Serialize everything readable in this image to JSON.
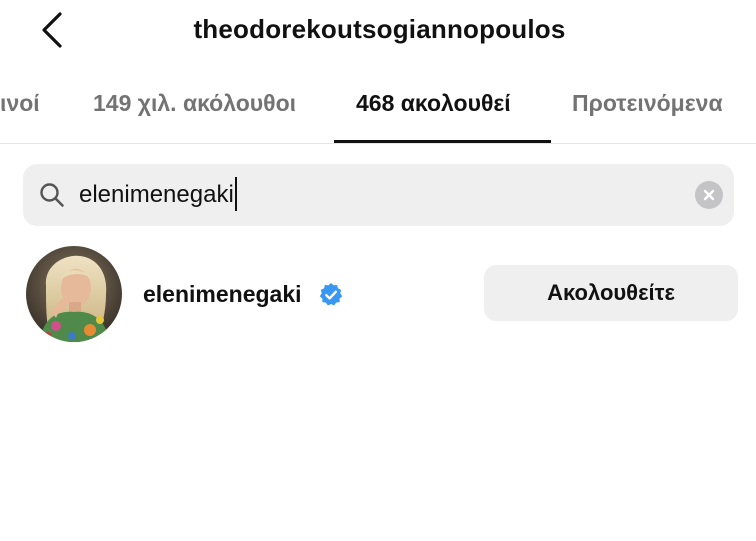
{
  "header": {
    "title": "theodorekoutsogiannopoulos",
    "back_icon": "chevron-left-icon"
  },
  "tabs": [
    {
      "label": "οινοί",
      "active": false
    },
    {
      "label": "149 χιλ. ακόλουθοι",
      "active": false
    },
    {
      "label": "468 ακολουθεί",
      "active": true
    },
    {
      "label": "Προτεινόμενα",
      "active": false
    }
  ],
  "search": {
    "value": "elenimenegaki",
    "icon": "search-icon",
    "clear_icon": "clear-icon"
  },
  "results": [
    {
      "username": "elenimenegaki",
      "verified": true,
      "button_label": "Ακολουθείτε"
    }
  ],
  "colors": {
    "verified_blue": "#3897f0",
    "search_bg": "#efeff0",
    "inactive_tab": "#737373"
  }
}
